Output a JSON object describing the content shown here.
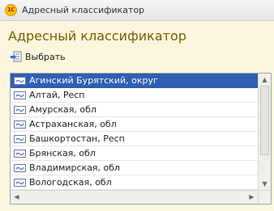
{
  "window": {
    "app_icon_text": "1С",
    "title": "Адресный классификатор"
  },
  "page": {
    "title": "Адресный классификатор"
  },
  "toolbar": {
    "select_label": "Выбрать",
    "select_icon": "select-list-icon"
  },
  "list": {
    "selected_index": 0,
    "items": [
      {
        "label": "Агинский Бурятский, округ"
      },
      {
        "label": "Алтай, Респ"
      },
      {
        "label": "Амурская, обл"
      },
      {
        "label": "Астраханская, обл"
      },
      {
        "label": "Башкортостан, Респ"
      },
      {
        "label": "Брянская, обл"
      },
      {
        "label": "Владимирская, обл"
      },
      {
        "label": "Вологодская, обл"
      }
    ]
  },
  "colors": {
    "background": "#fbf6dd",
    "page_title": "#7a5e00",
    "selection": "#2f5fb1"
  }
}
